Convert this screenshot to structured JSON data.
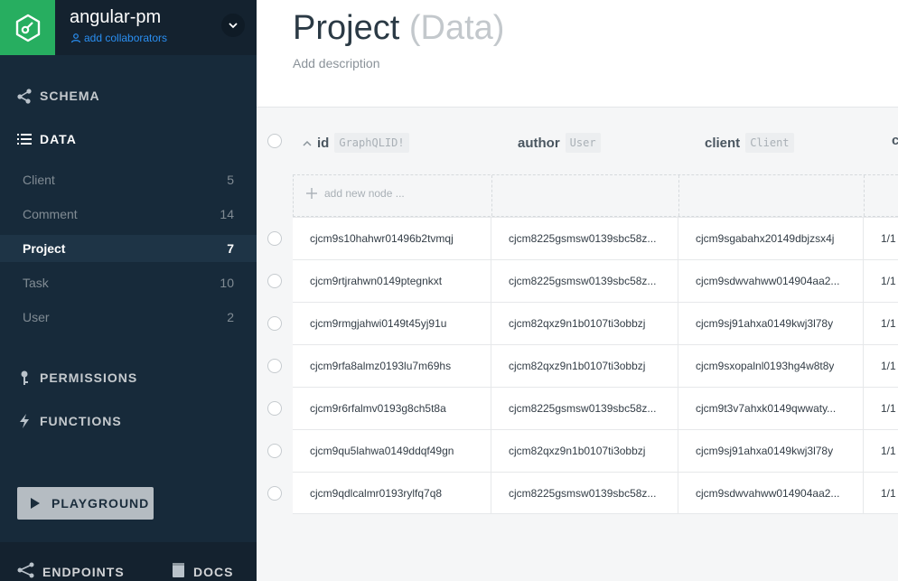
{
  "project": {
    "name": "angular-pm",
    "add_collaborators": "add collaborators"
  },
  "nav": {
    "schema": "SCHEMA",
    "data": "DATA",
    "permissions": "PERMISSIONS",
    "functions": "FUNCTIONS",
    "playground": "PLAYGROUND",
    "endpoints": "ENDPOINTS",
    "docs": "DOCS"
  },
  "models": [
    {
      "name": "Client",
      "count": "5"
    },
    {
      "name": "Comment",
      "count": "14"
    },
    {
      "name": "Project",
      "count": "7"
    },
    {
      "name": "Task",
      "count": "10"
    },
    {
      "name": "User",
      "count": "2"
    }
  ],
  "header": {
    "title": "Project",
    "subtitle": "(Data)",
    "description": "Add description"
  },
  "columns": [
    {
      "name": "id",
      "type": "GraphQLID!"
    },
    {
      "name": "author",
      "type": "User"
    },
    {
      "name": "client",
      "type": "Client"
    },
    {
      "name": "c"
    }
  ],
  "add_node": "add new node ...",
  "rows": [
    {
      "id": "cjcm9s10hahwr01496b2tvmqj",
      "author": "cjcm8225gsmsw0139sbc58z...",
      "client": "cjcm9sgabahx20149dbjzsx4j",
      "date": "1/1"
    },
    {
      "id": "cjcm9rtjrahwn0149ptegnkxt",
      "author": "cjcm8225gsmsw0139sbc58z...",
      "client": "cjcm9sdwvahww014904aa2...",
      "date": "1/1"
    },
    {
      "id": "cjcm9rmgjahwi0149t45yj91u",
      "author": "cjcm82qxz9n1b0107ti3obbzj",
      "client": "cjcm9sj91ahxa0149kwj3l78y",
      "date": "1/1"
    },
    {
      "id": "cjcm9rfa8almz0193lu7m69hs",
      "author": "cjcm82qxz9n1b0107ti3obbzj",
      "client": "cjcm9sxopalnl0193hg4w8t8y",
      "date": "1/1"
    },
    {
      "id": "cjcm9r6rfalmv0193g8ch5t8a",
      "author": "cjcm8225gsmsw0139sbc58z...",
      "client": "cjcm9t3v7ahxk0149qwwaty...",
      "date": "1/1"
    },
    {
      "id": "cjcm9qu5lahwa0149ddqf49gn",
      "author": "cjcm82qxz9n1b0107ti3obbzj",
      "client": "cjcm9sj91ahxa0149kwj3l78y",
      "date": "1/1"
    },
    {
      "id": "cjcm9qdlcalmr0193rylfq7q8",
      "author": "cjcm8225gsmsw0139sbc58z...",
      "client": "cjcm9sdwvahww014904aa2...",
      "date": "1/1"
    }
  ],
  "colors": {
    "sidebar": "#172a3a",
    "logo_green": "#27ae60",
    "link_blue": "#2a8ff2"
  }
}
